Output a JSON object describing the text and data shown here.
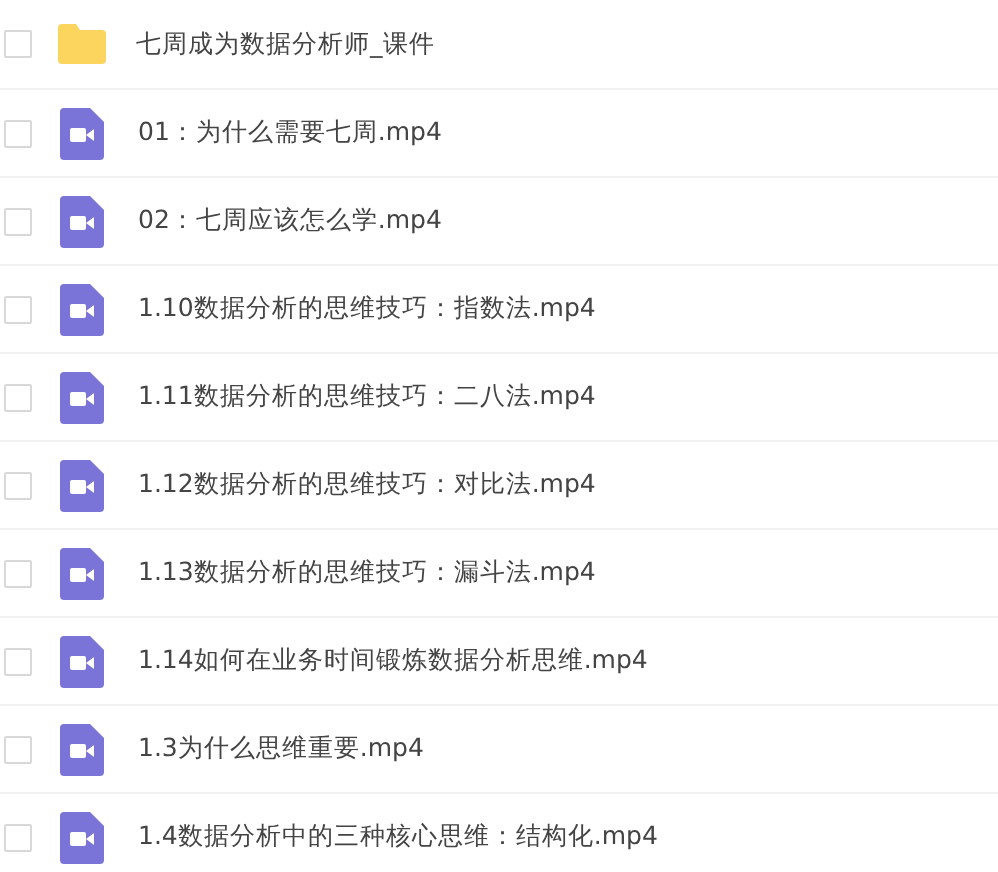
{
  "files": [
    {
      "kind": "folder",
      "name": "七周成为数据分析师_课件",
      "checked": false
    },
    {
      "kind": "video",
      "name": "01：为什么需要七周.mp4",
      "checked": false
    },
    {
      "kind": "video",
      "name": "02：七周应该怎么学.mp4",
      "checked": false
    },
    {
      "kind": "video",
      "name": "1.10数据分析的思维技巧：指数法.mp4",
      "checked": false
    },
    {
      "kind": "video",
      "name": "1.11数据分析的思维技巧：二八法.mp4",
      "checked": false
    },
    {
      "kind": "video",
      "name": "1.12数据分析的思维技巧：对比法.mp4",
      "checked": false
    },
    {
      "kind": "video",
      "name": "1.13数据分析的思维技巧：漏斗法.mp4",
      "checked": false
    },
    {
      "kind": "video",
      "name": "1.14如何在业务时间锻炼数据分析思维.mp4",
      "checked": false
    },
    {
      "kind": "video",
      "name": "1.3为什么思维重要.mp4",
      "checked": false
    },
    {
      "kind": "video",
      "name": "1.4数据分析中的三种核心思维：结构化.mp4",
      "checked": false
    }
  ]
}
